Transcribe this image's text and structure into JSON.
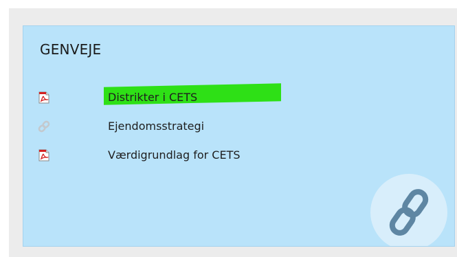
{
  "shortcuts": {
    "title": "GENVEJE",
    "items": [
      {
        "label": "Distrikter i CETS",
        "icon": "pdf-icon",
        "highlighted": true
      },
      {
        "label": "Ejendomsstrategi",
        "icon": "link-icon",
        "highlighted": false
      },
      {
        "label": "Værdigrundlag for CETS",
        "icon": "pdf-icon",
        "highlighted": false
      }
    ],
    "badge_icon": "link-icon"
  },
  "colors": {
    "panel_bg": "#b9e3fa",
    "frame_bg": "#ececec",
    "highlight": "#2ee016",
    "pdf_red": "#d42020"
  }
}
